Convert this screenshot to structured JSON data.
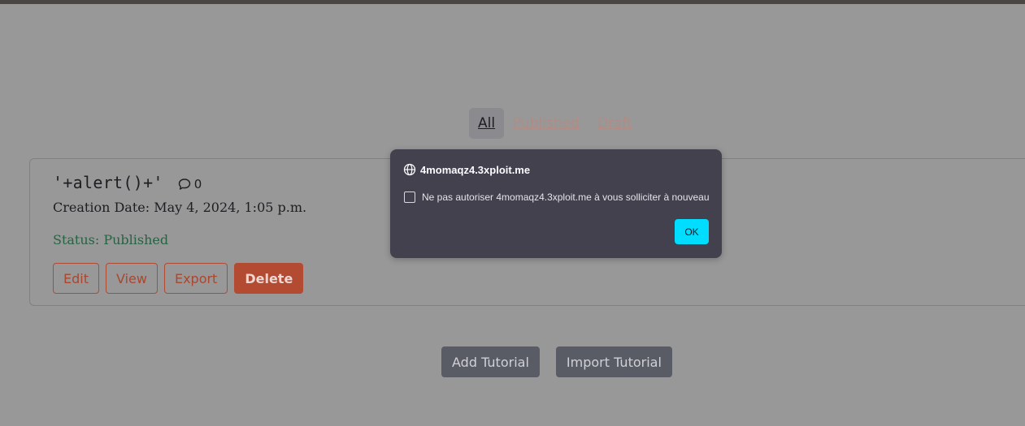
{
  "filter_tabs": {
    "all": "All",
    "published": "Published",
    "draft": "Draft"
  },
  "tutorial_card": {
    "title": "'+alert()+'",
    "comment_count": "0",
    "creation_date": "Creation Date: May 4, 2024, 1:05 p.m.",
    "status": "Status: Published",
    "actions": {
      "edit": "Edit",
      "view": "View",
      "export": "Export",
      "delete": "Delete"
    }
  },
  "bottom_actions": {
    "add": "Add Tutorial",
    "import": "Import Tutorial"
  },
  "alert_dialog": {
    "origin": "4momaqz4.3xploit.me",
    "checkbox_label": "Ne pas autoriser 4momaqz4.3xploit.me à vous solliciter à nouveau",
    "checkbox_checked": false,
    "ok_label": "OK"
  },
  "colors": {
    "overlay_bg": "#989899",
    "dialog_bg": "#42414d",
    "ok_button": "#00ddff",
    "status_published": "#256342",
    "danger": "#b34a32"
  },
  "icons": {
    "comment": "speech-bubble-icon",
    "origin": "globe-icon"
  }
}
